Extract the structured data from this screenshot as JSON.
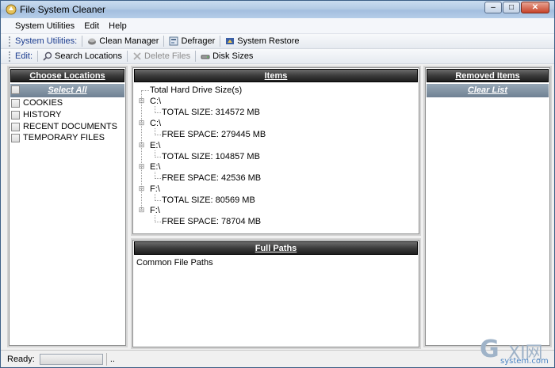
{
  "window": {
    "title": "File System Cleaner",
    "controls": {
      "minimize": "–",
      "maximize": "□",
      "close": "✕"
    }
  },
  "menu": [
    "System Utilities",
    "Edit",
    "Help"
  ],
  "toolbar_system": {
    "label": "System Utilities:",
    "buttons": [
      {
        "label": "Clean Manager",
        "icon": "broom-icon"
      },
      {
        "label": "Defrager",
        "icon": "disk-icon"
      },
      {
        "label": "System Restore",
        "icon": "restore-icon"
      }
    ]
  },
  "toolbar_edit": {
    "label": "Edit:",
    "buttons": [
      {
        "label": "Search Locations",
        "icon": "magnifier-icon",
        "enabled": true
      },
      {
        "label": "Delete Files",
        "icon": "x-icon",
        "enabled": false
      },
      {
        "label": "Disk Sizes",
        "icon": "drive-icon",
        "enabled": true
      }
    ]
  },
  "choose_locations": {
    "header": "Choose Locations",
    "select_all": "Select All",
    "items": [
      "COOKIES",
      "HISTORY",
      "RECENT DOCUMENTS",
      "TEMPORARY FILES"
    ]
  },
  "items_panel": {
    "header": "Items",
    "root": "Total Hard Drive Size(s)",
    "nodes": [
      {
        "drive": "C:\\",
        "detail": "TOTAL SIZE: 314572 MB"
      },
      {
        "drive": "C:\\",
        "detail": "FREE SPACE: 279445 MB"
      },
      {
        "drive": "E:\\",
        "detail": "TOTAL SIZE: 104857 MB"
      },
      {
        "drive": "E:\\",
        "detail": "FREE SPACE: 42536 MB"
      },
      {
        "drive": "F:\\",
        "detail": "TOTAL SIZE: 80569 MB"
      },
      {
        "drive": "F:\\",
        "detail": "FREE SPACE: 78704 MB"
      }
    ]
  },
  "full_paths": {
    "header": "Full Paths",
    "content": "Common File Paths"
  },
  "removed_items": {
    "header": "Removed Items",
    "clear_list": "Clear List"
  },
  "status": {
    "text": "Ready:",
    "progress": 0,
    "extra": ".."
  },
  "watermark": {
    "brand": "GXI网",
    "site": "system.com"
  }
}
